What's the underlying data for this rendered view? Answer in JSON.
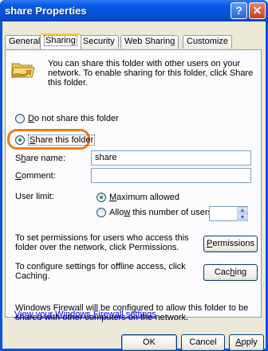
{
  "window": {
    "title": "share Properties",
    "help_glyph": "?",
    "close_glyph": "✕"
  },
  "tabs": [
    {
      "label": "General"
    },
    {
      "label": "Sharing"
    },
    {
      "label": "Security"
    },
    {
      "label": "Web Sharing"
    },
    {
      "label": "Customize"
    }
  ],
  "sharing": {
    "intro": "You can share this folder with other users on your network.  To enable sharing for this folder, click Share this folder.",
    "radio_do_not_share_a": "D",
    "radio_do_not_share_b": "o not share this folder",
    "radio_share_a": "S",
    "radio_share_b": "hare this folder",
    "share_name_label_a": "S",
    "share_name_label_u": "h",
    "share_name_label_b": "are name:",
    "share_name_value": "share",
    "comment_label_u": "C",
    "comment_label_b": "omment:",
    "comment_value": "",
    "user_limit_label": "User limit:",
    "max_allowed_u": "M",
    "max_allowed_b": "aximum allowed",
    "allow_num_a": "Allo",
    "allow_num_u": "w",
    "allow_num_b": " this number of users:",
    "allow_num_value": "",
    "permissions_text": "To set permissions for users who access this folder over the network, click Permissions.",
    "permissions_button_u": "P",
    "permissions_button_b": "ermissions",
    "caching_text": "To configure settings for offline access, click Caching.",
    "caching_button_a": "Cac",
    "caching_button_u": "h",
    "caching_button_b": "ing",
    "firewall_text": "Windows Firewall will be configured to allow this folder to be shared with other computers on the network.",
    "firewall_link": "View your Windows Firewall settings"
  },
  "buttons": {
    "ok": "OK",
    "cancel": "Cancel",
    "apply_u": "A",
    "apply_b": "pply"
  },
  "colors": {
    "titlebar": "#0550d6",
    "highlight": "#f07a1a",
    "link": "#0000ff",
    "face": "#ece9d8"
  }
}
